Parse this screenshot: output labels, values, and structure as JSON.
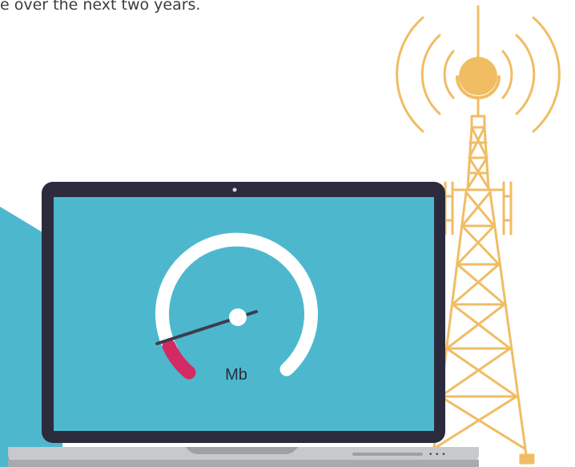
{
  "caption": "e over the next two years.",
  "gauge": {
    "unit_label": "Mb"
  },
  "laptop": {
    "indicator_dots": "• • •"
  },
  "colors": {
    "screen": "#4db8cd",
    "bezel": "#2c2b3d",
    "tower": "#f0bd63",
    "gauge_arc": "#ffffff",
    "gauge_needle": "#3d3d4f",
    "gauge_red_zone": "#d42a64",
    "base": "#c8c9cc",
    "accent_shape": "#4db8cd"
  }
}
